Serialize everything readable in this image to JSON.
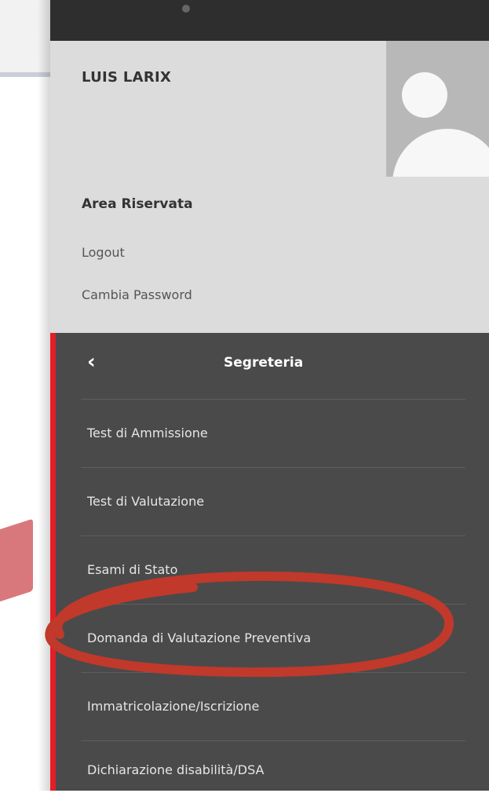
{
  "user": {
    "name": "LUIS LARIX",
    "area_title": "Area Riservata",
    "logout_label": "Logout",
    "change_password_label": "Cambia Password"
  },
  "menu": {
    "title": "Segreteria",
    "back_icon": "chevron-left-icon",
    "items": [
      {
        "label": "Test di Ammissione"
      },
      {
        "label": "Test di Valutazione"
      },
      {
        "label": "Esami di Stato"
      },
      {
        "label": "Domanda di Valutazione Preventiva"
      },
      {
        "label": "Immatricolazione/Iscrizione"
      },
      {
        "label": "Dichiarazione disabilità/DSA"
      }
    ]
  },
  "colors": {
    "sidebar_bg": "#4a4a4a",
    "user_panel_bg": "#dcdcdc",
    "accent_red": "#e41e26",
    "annotation_red": "#c0392b"
  }
}
